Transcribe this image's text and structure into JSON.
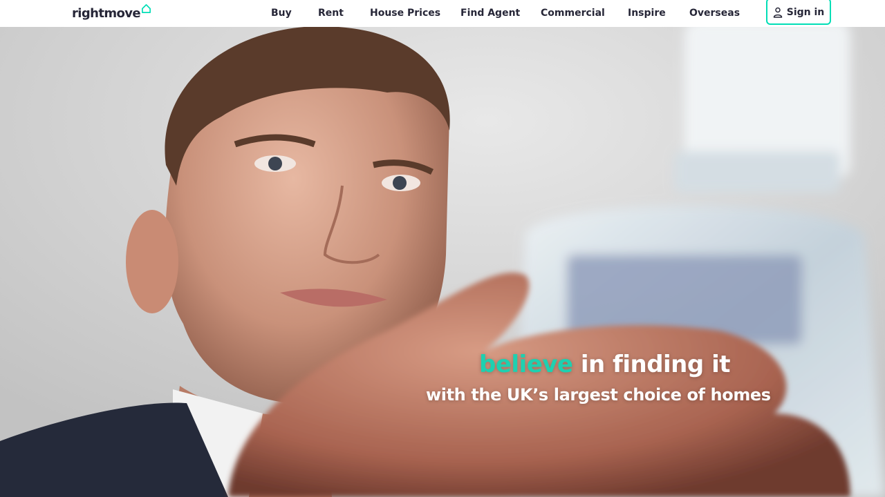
{
  "header": {
    "logo_text": "rightmove",
    "logo_icon": "house-outline-icon",
    "nav": [
      {
        "label": "Buy"
      },
      {
        "label": "Rent"
      },
      {
        "label": "House Prices"
      },
      {
        "label": "Find Agent"
      },
      {
        "label": "Commercial"
      },
      {
        "label": "Inspire"
      },
      {
        "label": "Overseas"
      }
    ],
    "sign_in_label": "Sign in",
    "sign_in_icon": "user-icon"
  },
  "hero": {
    "headline_accent": "believe",
    "headline_rest": "in finding it",
    "subheadline": "with the UK’s largest choice of homes",
    "image_description_icon": "hero-video-frame"
  },
  "colors": {
    "accent": "#1ed0b0",
    "button_border": "#00deb6",
    "text_dark": "#262637",
    "nav_background": "#ffffff"
  }
}
